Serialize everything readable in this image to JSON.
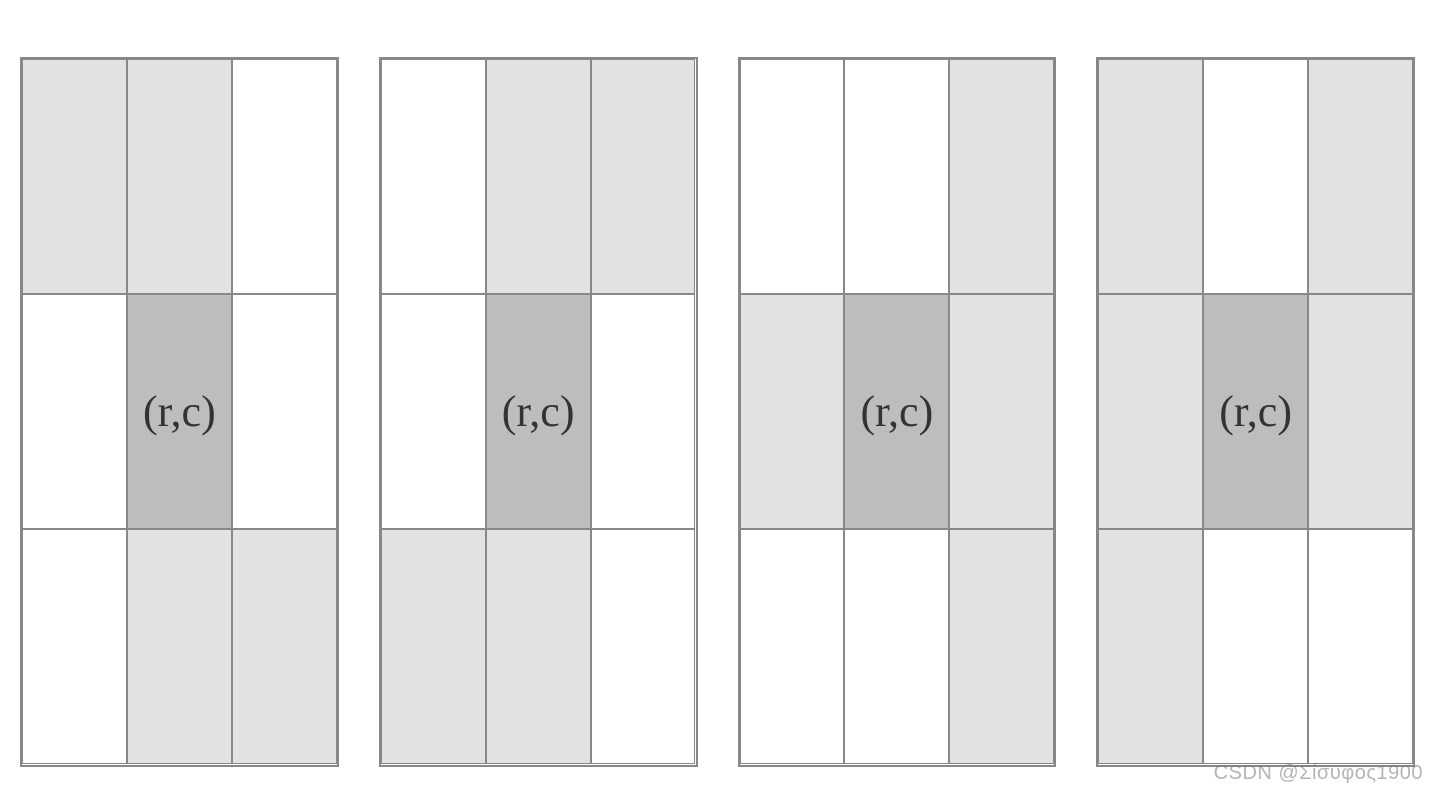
{
  "center_label": "(r,c)",
  "watermark": "CSDN @Σίσυφος1900",
  "grids": [
    {
      "cells": [
        {
          "shade": "light"
        },
        {
          "shade": "light"
        },
        {
          "shade": "white"
        },
        {
          "shade": "white"
        },
        {
          "shade": "dark",
          "center": true
        },
        {
          "shade": "white"
        },
        {
          "shade": "white"
        },
        {
          "shade": "light"
        },
        {
          "shade": "light"
        }
      ]
    },
    {
      "cells": [
        {
          "shade": "white"
        },
        {
          "shade": "light"
        },
        {
          "shade": "light"
        },
        {
          "shade": "white"
        },
        {
          "shade": "dark",
          "center": true
        },
        {
          "shade": "white"
        },
        {
          "shade": "light"
        },
        {
          "shade": "light"
        },
        {
          "shade": "white"
        }
      ]
    },
    {
      "cells": [
        {
          "shade": "white"
        },
        {
          "shade": "white"
        },
        {
          "shade": "light"
        },
        {
          "shade": "light"
        },
        {
          "shade": "dark",
          "center": true
        },
        {
          "shade": "light"
        },
        {
          "shade": "white"
        },
        {
          "shade": "white"
        },
        {
          "shade": "light"
        }
      ]
    },
    {
      "cells": [
        {
          "shade": "light"
        },
        {
          "shade": "white"
        },
        {
          "shade": "light"
        },
        {
          "shade": "light"
        },
        {
          "shade": "dark",
          "center": true
        },
        {
          "shade": "light"
        },
        {
          "shade": "light"
        },
        {
          "shade": "white"
        },
        {
          "shade": "white"
        }
      ]
    }
  ]
}
